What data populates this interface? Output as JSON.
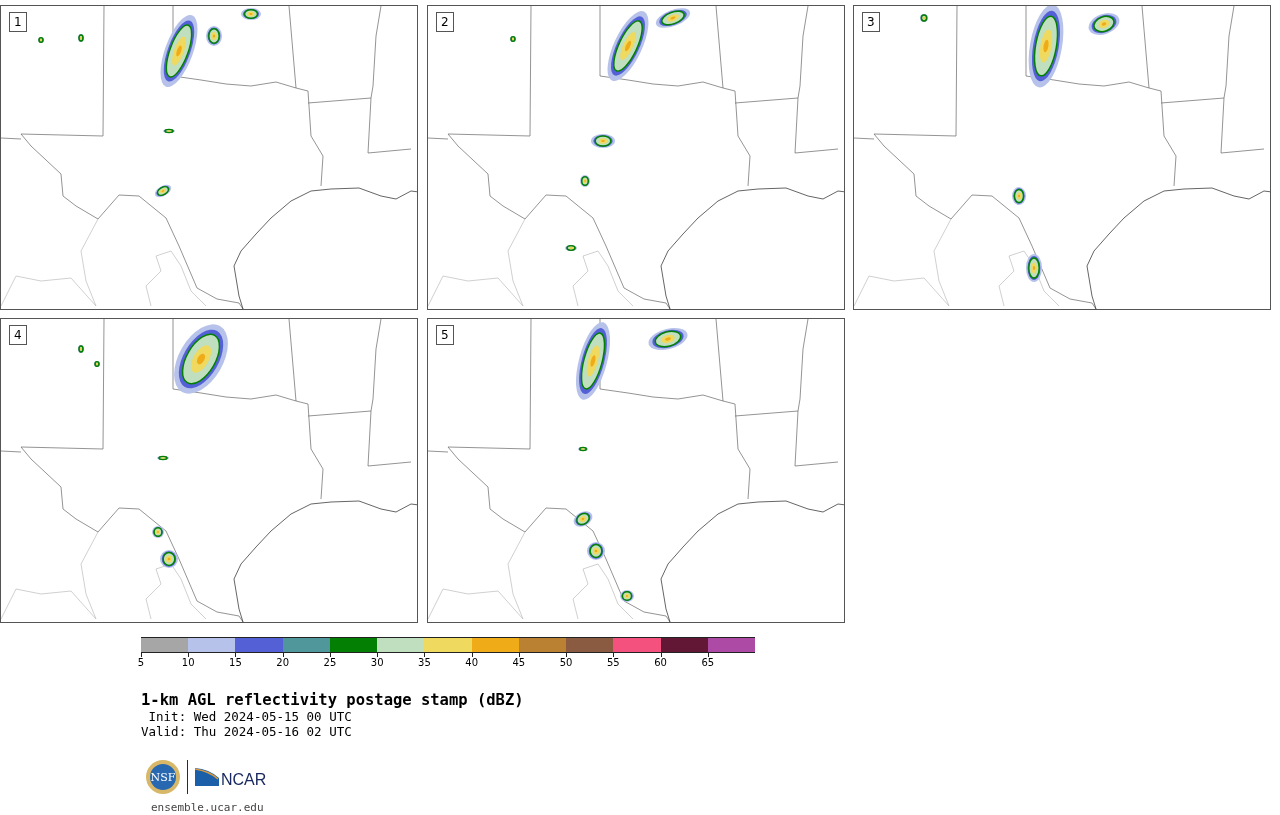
{
  "panels": [
    {
      "label": "1"
    },
    {
      "label": "2"
    },
    {
      "label": "3"
    },
    {
      "label": "4"
    },
    {
      "label": "5"
    }
  ],
  "colorbar": {
    "bins": [
      {
        "tick": "5",
        "color": "#a6a6a6"
      },
      {
        "tick": "10",
        "color": "#b7c2eb"
      },
      {
        "tick": "15",
        "color": "#5461d6"
      },
      {
        "tick": "20",
        "color": "#4f979b"
      },
      {
        "tick": "25",
        "color": "#038003"
      },
      {
        "tick": "30",
        "color": "#bfdfbf"
      },
      {
        "tick": "35",
        "color": "#efd95f"
      },
      {
        "tick": "40",
        "color": "#efac18"
      },
      {
        "tick": "45",
        "color": "#b98131"
      },
      {
        "tick": "50",
        "color": "#8b5b41"
      },
      {
        "tick": "55",
        "color": "#f4517e"
      },
      {
        "tick": "60",
        "color": "#621735"
      },
      {
        "tick": "65",
        "color": "#ac4aa6"
      }
    ]
  },
  "title": "1-km AGL reflectivity postage stamp (dBZ)",
  "init": " Init: Wed 2024-05-15 00 UTC",
  "valid": "Valid: Thu 2024-05-16 02 UTC",
  "logos": {
    "nsf": "NSF",
    "ncar": "NCAR"
  },
  "url": "ensemble.ucar.edu"
}
